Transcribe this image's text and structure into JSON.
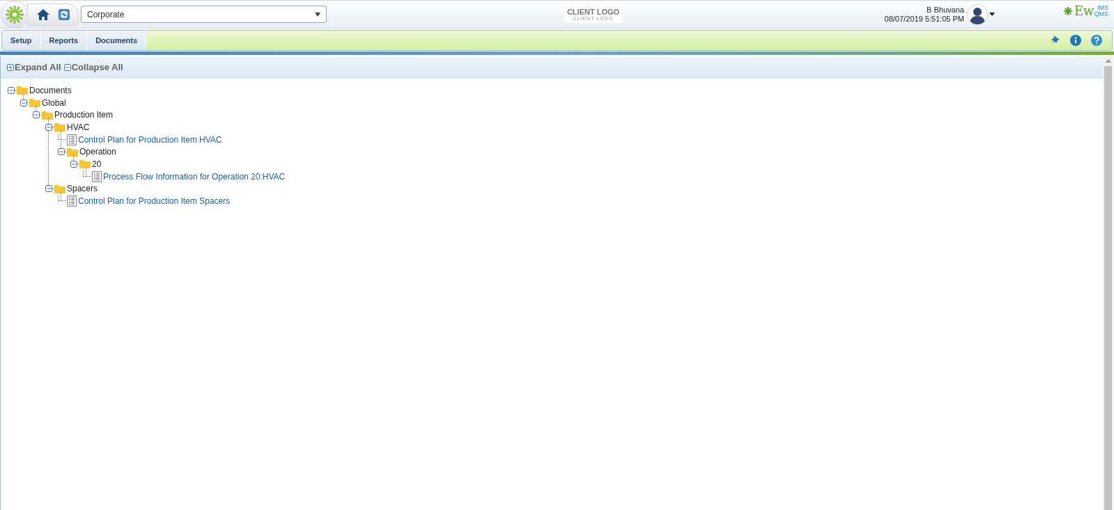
{
  "header": {
    "site_select": {
      "value": "Corporate"
    },
    "client_logo": {
      "title": "CLIENT LOGO",
      "subtitle": "CLIENT LOGO"
    },
    "user": {
      "name": "B Bhuvana",
      "datetime": "08/07/2019 5:51:05 PM"
    },
    "brand": {
      "main": "Ew",
      "top": "IMS",
      "bottom": "QMS"
    }
  },
  "menu": [
    {
      "label": "Setup"
    },
    {
      "label": "Reports"
    },
    {
      "label": "Documents"
    }
  ],
  "toolbar": {
    "expand_all": "Expand All",
    "collapse_all": "Collapse All"
  },
  "tree": [
    {
      "label": "Documents",
      "kind": "folder",
      "expanded": true,
      "children": [
        {
          "label": "Global",
          "kind": "folder",
          "expanded": true,
          "children": [
            {
              "label": "Production Item",
              "kind": "folder",
              "expanded": true,
              "children": [
                {
                  "label": "HVAC",
                  "kind": "folder",
                  "expanded": true,
                  "children": [
                    {
                      "label": "Control Plan for Production Item HVAC",
                      "kind": "document"
                    },
                    {
                      "label": "Operation",
                      "kind": "folder",
                      "expanded": true,
                      "children": [
                        {
                          "label": "20",
                          "kind": "folder",
                          "expanded": true,
                          "children": [
                            {
                              "label": "Process Flow Information for Operation 20:HVAC",
                              "kind": "document"
                            }
                          ]
                        }
                      ]
                    }
                  ]
                },
                {
                  "label": "Spacers",
                  "kind": "folder",
                  "expanded": true,
                  "children": [
                    {
                      "label": "Control Plan for Production Item Spacers",
                      "kind": "document"
                    }
                  ]
                }
              ]
            }
          ]
        }
      ]
    }
  ]
}
